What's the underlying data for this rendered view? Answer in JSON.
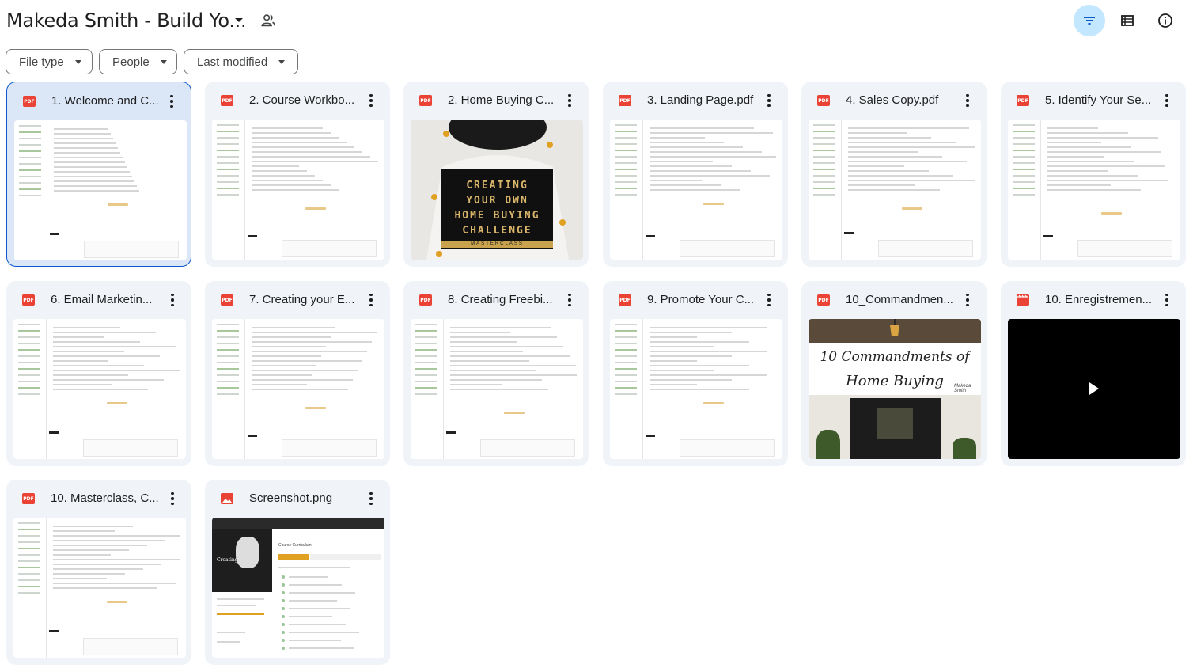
{
  "header": {
    "title": "Makeda Smith - Build Yo...",
    "caret_icon": "arrow-drop-down-icon",
    "share_icon": "people-icon",
    "filter_icon": "filter-icon",
    "list_view_icon": "list-view-icon",
    "info_icon": "info-icon"
  },
  "filters": [
    {
      "label": "File type"
    },
    {
      "label": "People"
    },
    {
      "label": "Last modified"
    }
  ],
  "files": [
    {
      "name": "1. Welcome and C...",
      "type": "pdf",
      "badge": "PDF",
      "thumb": "doc",
      "selected": true
    },
    {
      "name": "2. Course Workbo...",
      "type": "pdf",
      "badge": "PDF",
      "thumb": "doc"
    },
    {
      "name": "2. Home Buying C...",
      "type": "pdf",
      "badge": "PDF",
      "thumb": "cover",
      "cover_text": [
        "CREATING",
        "YOUR OWN",
        "HOME BUYING",
        "CHALLENGE"
      ],
      "cover_sub": "MASTERCLASS"
    },
    {
      "name": "3. Landing Page.pdf",
      "type": "pdf",
      "badge": "PDF",
      "thumb": "doc"
    },
    {
      "name": "4. Sales Copy.pdf",
      "type": "pdf",
      "badge": "PDF",
      "thumb": "doc"
    },
    {
      "name": "5. Identify Your Se...",
      "type": "pdf",
      "badge": "PDF",
      "thumb": "doc"
    },
    {
      "name": "6. Email Marketin...",
      "type": "pdf",
      "badge": "PDF",
      "thumb": "doc"
    },
    {
      "name": "7. Creating your E...",
      "type": "pdf",
      "badge": "PDF",
      "thumb": "doc"
    },
    {
      "name": "8. Creating Freebi...",
      "type": "pdf",
      "badge": "PDF",
      "thumb": "doc"
    },
    {
      "name": "9. Promote Your C...",
      "type": "pdf",
      "badge": "PDF",
      "thumb": "doc"
    },
    {
      "name": "10_Commandmen...",
      "type": "pdf",
      "badge": "PDF",
      "thumb": "commandments",
      "cover_text": [
        "10 Commandments of",
        "Home Buying"
      ],
      "signature": "Makeda Smith"
    },
    {
      "name": "10. Enregistremen...",
      "type": "video",
      "badge": "",
      "thumb": "video"
    },
    {
      "name": "10. Masterclass, C...",
      "type": "pdf",
      "badge": "PDF",
      "thumb": "doc"
    },
    {
      "name": "Screenshot.png",
      "type": "image",
      "badge": "",
      "thumb": "screenshot",
      "screenshot_title": "Course Curriculum"
    }
  ],
  "colors": {
    "card_bg": "#f0f4f9",
    "selected_bg": "#dbe7f7",
    "accent": "#0b57d0",
    "active_btn": "#c2e7ff",
    "pdf_red": "#ea4335"
  }
}
